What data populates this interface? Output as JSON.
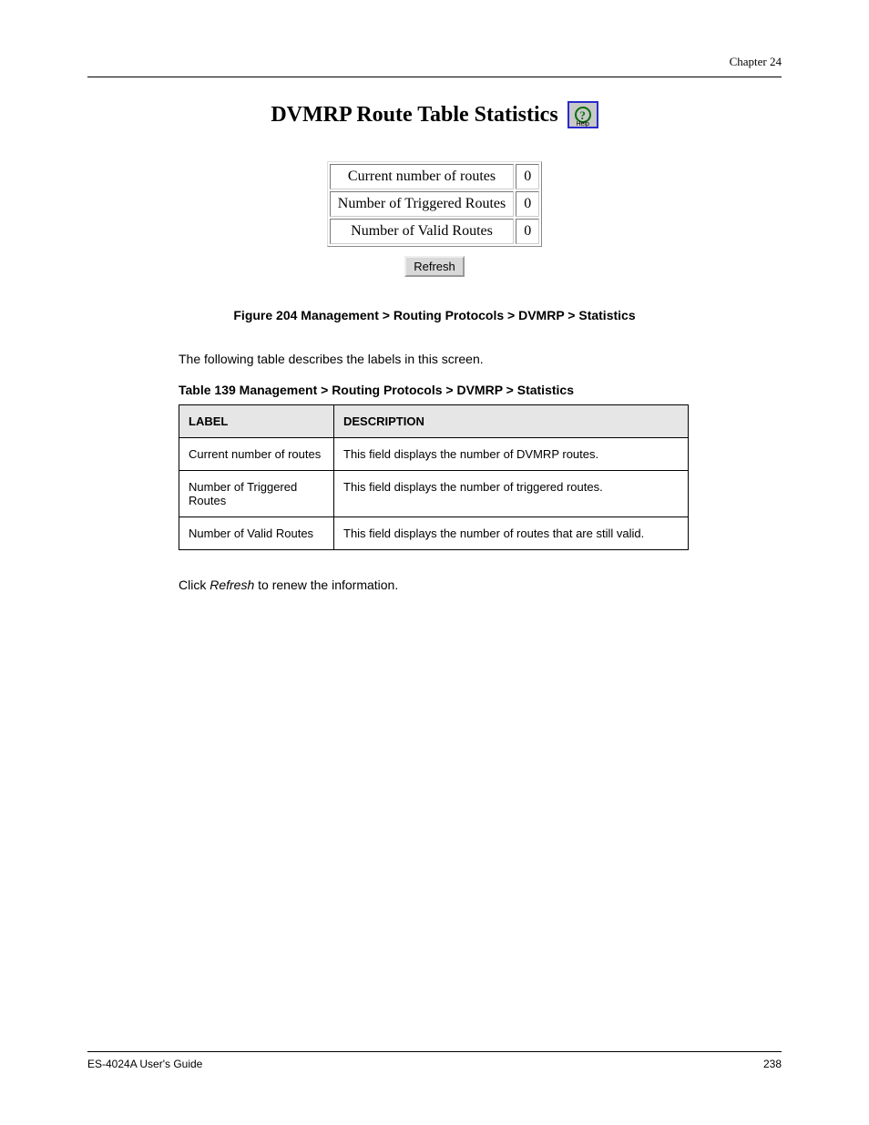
{
  "header": {
    "chapter_ref": "Chapter 24"
  },
  "panel": {
    "title": "DVMRP Route Table Statistics",
    "help_alt": "Help",
    "rows": [
      {
        "label": "Current number of routes",
        "value": "0"
      },
      {
        "label": "Number of Triggered Routes",
        "value": "0"
      },
      {
        "label": "Number of Valid Routes",
        "value": "0"
      }
    ],
    "refresh_label": "Refresh"
  },
  "figure_caption": "Figure 204   Management > Routing Protocols > DVMRP > Statistics",
  "def": {
    "intro": "The following table describes the labels in this screen.",
    "table_caption": "Table 139   Management > Routing Protocols > DVMRP > Statistics",
    "columns": [
      "LABEL",
      "DESCRIPTION"
    ],
    "rows": [
      {
        "label": "Current number of routes",
        "desc": "This field displays the number of DVMRP routes."
      },
      {
        "label": "Number of Triggered Routes",
        "desc": "This field displays the number of triggered routes."
      },
      {
        "label": "Number of Valid Routes",
        "desc": "This field displays the number of routes that are still valid."
      }
    ],
    "action_prefix": "Click ",
    "action_button": "Refresh",
    "action_suffix": " to renew the information."
  },
  "footer": {
    "left": "ES-4024A User's Guide",
    "right": "238"
  }
}
